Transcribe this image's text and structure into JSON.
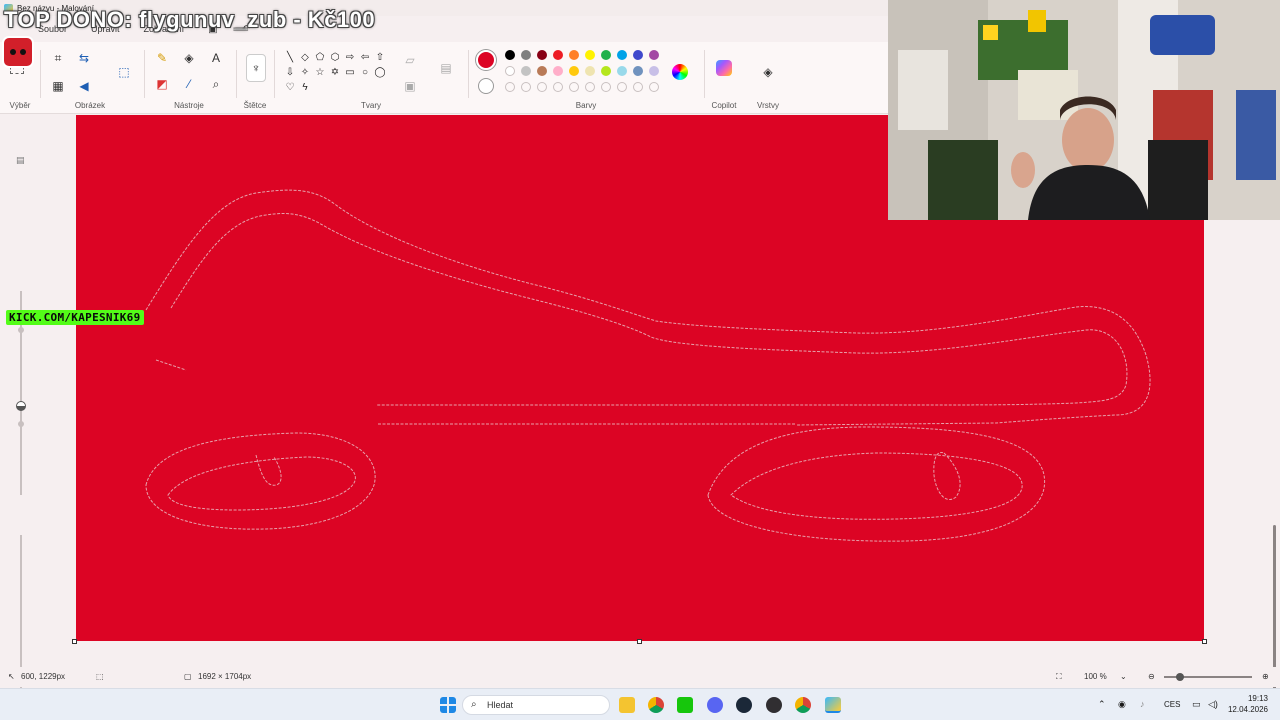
{
  "window": {
    "title": "Bez názvu - Malování"
  },
  "overlay": {
    "donor_text": "TOP DONO: flygunuv_zub - Kč100",
    "kick_text": "KICK.COM/KAPESNIK69"
  },
  "menu": {
    "file": "Soubor",
    "edit": "Upravit",
    "view": "Zobrazení"
  },
  "ribbon": {
    "groups": {
      "selection": "Výběr",
      "image": "Obrázek",
      "tools": "Nástroje",
      "brushes": "Štětce",
      "shapes": "Tvary",
      "colors": "Barvy",
      "copilot": "Copilot",
      "layers": "Vrstvy"
    },
    "active_color": "#dc0424",
    "palette_row1": [
      "#000000",
      "#7f7f7f",
      "#880015",
      "#ed1c24",
      "#ff7f27",
      "#fff200",
      "#22b14c",
      "#00a2e8",
      "#3f48cc",
      "#a349a4"
    ],
    "palette_row2": [
      "#ffffff",
      "#c3c3c3",
      "#b97a57",
      "#ffaec9",
      "#ffc90e",
      "#efe4b0",
      "#b5e61d",
      "#99d9ea",
      "#7092be",
      "#c8bfe7"
    ]
  },
  "status": {
    "cursor_position": "600, 1229px",
    "canvas_size": "1692 × 1704px",
    "zoom": "100 %"
  },
  "taskbar": {
    "search_placeholder": "Hledat",
    "language": "CES",
    "time": "19:13",
    "date": "12.04.2026"
  }
}
